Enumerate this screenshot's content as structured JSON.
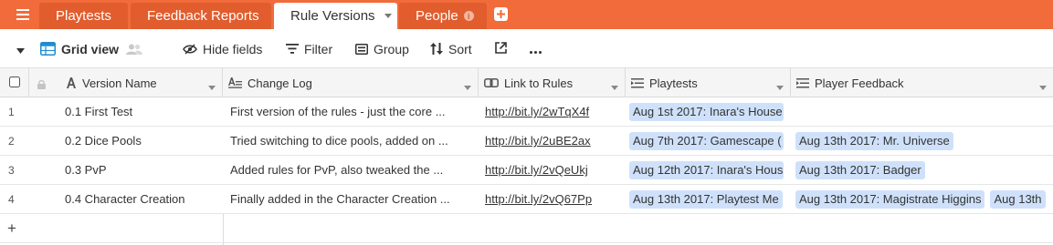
{
  "tabs": [
    {
      "label": "Playtests",
      "active": false
    },
    {
      "label": "Feedback Reports",
      "active": false
    },
    {
      "label": "Rule Versions",
      "active": true
    },
    {
      "label": "People",
      "active": false
    }
  ],
  "toolbar": {
    "view_name": "Grid view",
    "hide_fields": "Hide fields",
    "filter": "Filter",
    "group": "Group",
    "sort": "Sort"
  },
  "columns": {
    "version_name": "Version Name",
    "change_log": "Change Log",
    "link_to_rules": "Link to Rules",
    "playtests": "Playtests",
    "player_feedback": "Player Feedback"
  },
  "rows": [
    {
      "num": "1",
      "version_name": "0.1 First Test",
      "change_log": "First version of the rules - just the core ...",
      "link": "http://bit.ly/2wTqX4f",
      "playtests": [
        "Aug 1st 2017: Inara's House"
      ],
      "feedback": []
    },
    {
      "num": "2",
      "version_name": "0.2 Dice Pools",
      "change_log": "Tried switching to dice pools, added on ...",
      "link": "http://bit.ly/2uBE2ax",
      "playtests": [
        "Aug 7th 2017: Gamescape ("
      ],
      "feedback": [
        "Aug 13th 2017: Mr. Universe"
      ]
    },
    {
      "num": "3",
      "version_name": "0.3 PvP",
      "change_log": "Added rules for PvP, also tweaked the ...",
      "link": "http://bit.ly/2vQeUkj",
      "playtests": [
        "Aug 12th 2017: Inara's Hous"
      ],
      "feedback": [
        "Aug 13th 2017: Badger"
      ]
    },
    {
      "num": "4",
      "version_name": "0.4 Character Creation",
      "change_log": "Finally added in the Character Creation ...",
      "link": "http://bit.ly/2vQ67Pp",
      "playtests": [
        "Aug 13th 2017: Playtest Me"
      ],
      "feedback": [
        "Aug 13th 2017: Magistrate Higgins",
        "Aug 13th"
      ]
    }
  ],
  "add_row": "+",
  "colors": {
    "brand": "#f26b3a",
    "tab_inactive": "#e15d2e",
    "chip": "#cfe1fa",
    "view_icon": "#1f8ccf"
  },
  "icons": [
    "menu-icon",
    "chevron-down-icon",
    "info-icon",
    "plus-icon",
    "grid-view-icon",
    "shared-people-icon",
    "hide-fields-icon",
    "filter-icon",
    "group-icon",
    "sort-icon",
    "share-icon",
    "more-icon",
    "checkbox-icon",
    "lock-icon",
    "text-field-icon",
    "long-text-icon",
    "link-field-icon"
  ]
}
